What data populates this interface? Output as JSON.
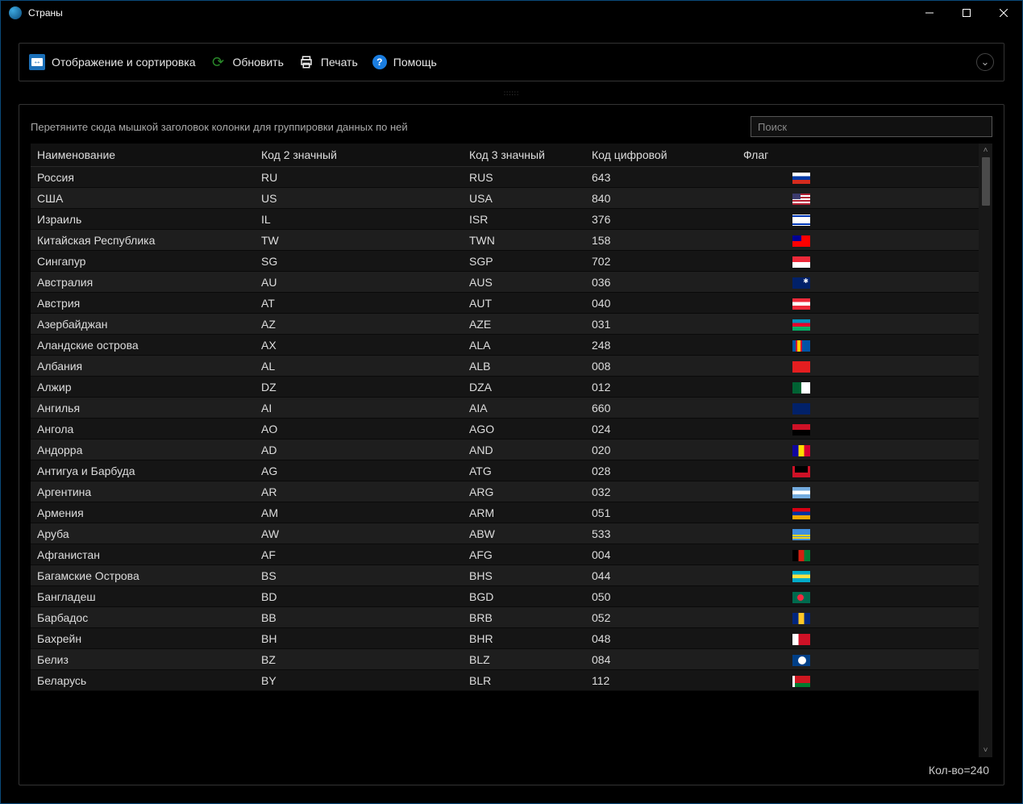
{
  "window": {
    "title": "Страны"
  },
  "toolbar": {
    "sort_label": "Отображение и сортировка",
    "refresh_label": "Обновить",
    "print_label": "Печать",
    "help_label": "Помощь"
  },
  "group_hint": "Перетяните сюда мышкой заголовок колонки для группировки данных по ней",
  "search_placeholder": "Поиск",
  "columns": {
    "name": "Наименование",
    "code2": "Код 2 значный",
    "code3": "Код 3 значный",
    "codenum": "Код цифровой",
    "flag": "Флаг"
  },
  "rows": [
    {
      "name": "Россия",
      "c2": "RU",
      "c3": "RUS",
      "num": "643",
      "flag": "f-ru"
    },
    {
      "name": "США",
      "c2": "US",
      "c3": "USA",
      "num": "840",
      "flag": "f-us"
    },
    {
      "name": "Израиль",
      "c2": "IL",
      "c3": "ISR",
      "num": "376",
      "flag": "f-il"
    },
    {
      "name": "Китайская Республика",
      "c2": "TW",
      "c3": "TWN",
      "num": "158",
      "flag": "f-tw"
    },
    {
      "name": "Сингапур",
      "c2": "SG",
      "c3": "SGP",
      "num": "702",
      "flag": "f-sg"
    },
    {
      "name": "Австралия",
      "c2": "AU",
      "c3": "AUS",
      "num": "036",
      "flag": "f-au"
    },
    {
      "name": "Австрия",
      "c2": "AT",
      "c3": "AUT",
      "num": "040",
      "flag": "f-at"
    },
    {
      "name": "Азербайджан",
      "c2": "AZ",
      "c3": "AZE",
      "num": "031",
      "flag": "f-az"
    },
    {
      "name": "Аландские острова",
      "c2": "AX",
      "c3": "ALA",
      "num": "248",
      "flag": "f-ax"
    },
    {
      "name": "Албания",
      "c2": "AL",
      "c3": "ALB",
      "num": "008",
      "flag": "f-al"
    },
    {
      "name": "Алжир",
      "c2": "DZ",
      "c3": "DZA",
      "num": "012",
      "flag": "f-dz"
    },
    {
      "name": "Ангилья",
      "c2": "AI",
      "c3": "AIA",
      "num": "660",
      "flag": "f-ai"
    },
    {
      "name": "Ангола",
      "c2": "AO",
      "c3": "AGO",
      "num": "024",
      "flag": "f-ao"
    },
    {
      "name": "Андорра",
      "c2": "AD",
      "c3": "AND",
      "num": "020",
      "flag": "f-ad"
    },
    {
      "name": "Антигуа и Барбуда",
      "c2": "AG",
      "c3": "ATG",
      "num": "028",
      "flag": "f-ag"
    },
    {
      "name": "Аргентина",
      "c2": "AR",
      "c3": "ARG",
      "num": "032",
      "flag": "f-ar"
    },
    {
      "name": "Армения",
      "c2": "AM",
      "c3": "ARM",
      "num": "051",
      "flag": "f-am"
    },
    {
      "name": "Аруба",
      "c2": "AW",
      "c3": "ABW",
      "num": "533",
      "flag": "f-aw"
    },
    {
      "name": "Афганистан",
      "c2": "AF",
      "c3": "AFG",
      "num": "004",
      "flag": "f-af"
    },
    {
      "name": "Багамские Острова",
      "c2": "BS",
      "c3": "BHS",
      "num": "044",
      "flag": "f-bs"
    },
    {
      "name": "Бангладеш",
      "c2": "BD",
      "c3": "BGD",
      "num": "050",
      "flag": "f-bd"
    },
    {
      "name": "Барбадос",
      "c2": "BB",
      "c3": "BRB",
      "num": "052",
      "flag": "f-bb"
    },
    {
      "name": "Бахрейн",
      "c2": "BH",
      "c3": "BHR",
      "num": "048",
      "flag": "f-bh"
    },
    {
      "name": "Белиз",
      "c2": "BZ",
      "c3": "BLZ",
      "num": "084",
      "flag": "f-bz"
    },
    {
      "name": "Беларусь",
      "c2": "BY",
      "c3": "BLR",
      "num": "112",
      "flag": "f-by"
    }
  ],
  "footer": {
    "count_label": "Кол-во=240"
  }
}
